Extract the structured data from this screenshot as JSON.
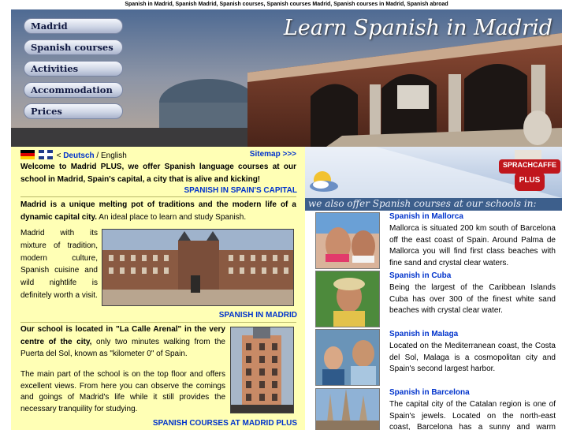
{
  "keywords_line": "Spanish in Madrid, Spanish Madrid, Spanish courses, Spanish courses Madrid, Spanish courses in Madrid, Spanish abroad",
  "header": {
    "title": "Learn Spanish in Madrid",
    "nav": [
      "Madrid",
      "Spanish courses",
      "Activities",
      "Accommodation",
      "Prices"
    ]
  },
  "lang": {
    "prefix": "<",
    "german": "Deutsch",
    "separator": " / English",
    "sitemap": "Sitemap >>>"
  },
  "intro": {
    "text": "Welcome to Madrid PLUS, we offer Spanish language courses at our school in Madrid, Spain's capital, a city that is alive and kicking!",
    "link": "SPANISH IN SPAIN'S CAPITAL"
  },
  "madrid": {
    "bold_text": "Madrid is a unique melting pot of traditions and the modern life of a dynamic capital city.",
    "text": " An ideal place to learn and study Spanish.",
    "side_text": "Madrid with its mixture of tradition, modern culture, Spanish cuisine and wild nightlife is definitely worth a visit.",
    "link": "SPANISH IN MADRID"
  },
  "school": {
    "bold_text": "Our school is located in \"La Calle Arenal\" in the very centre of the city,",
    "text": " only two minutes walking from the Puerta del Sol, known as \"kilometer 0\" of Spain.",
    "text2": "The main part of the school is on the top floor and offers excellent views. From here you can observe the comings and goings of Madrid's life while it still provides the necessary tranquility for studying.",
    "link": "SPANISH COURSES AT MADRID PLUS"
  },
  "right": {
    "offer_banner": "we also offer Spanish courses at our schools in:",
    "logo_top": "SPRACHCAFFE",
    "logo_bottom": "PLUS",
    "schools": [
      {
        "title": "Spanish in Mallorca",
        "text": "Mallorca is situated 200 km south of Barcelona off the east coast of Spain. Around Palma de Mallorca you will find first class beaches with fine sand and crystal clear waters."
      },
      {
        "title": "Spanish in Cuba",
        "text": "Being the largest of the Caribbean Islands Cuba has over 300 of the finest white sand beaches with crystal clear water."
      },
      {
        "title": "Spanish in Malaga",
        "text": "Located on the Mediterranean coast, the Costa del Sol, Malaga is a cosmopolitan city and Spain's second largest harbor."
      },
      {
        "title": "Spanish in Barcelona",
        "text": "The capital city of the Catalan region is one of Spain's jewels. Located on the north-east coast, Barcelona has a sunny and warm climate."
      }
    ]
  }
}
